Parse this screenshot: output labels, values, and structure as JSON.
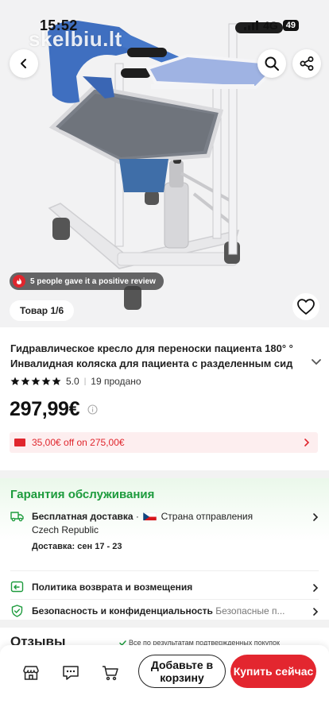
{
  "status_bar": {
    "time": "15:52",
    "network": "4G",
    "battery": "49"
  },
  "watermark": "skelbiu.lt",
  "hero": {
    "review_badge": "5 people gave it a positive review",
    "image_counter": "Товар 1/6"
  },
  "product": {
    "title_line1": "Гидравлическое кресло для переноски пациента 180° °",
    "title_line2": "Инвалидная коляска для пациента с разделенным сид",
    "rating": "5.0",
    "sold": "19 продано",
    "price": "297,99€",
    "coupon": "35,00€ off on 275,00€"
  },
  "guarantee": {
    "title": "Гарантия обслуживания",
    "shipping_label": "Бесплатная доставка",
    "ship_from_label": "Страна отправления",
    "ship_from_country": "Czech Republic",
    "delivery": "Доставка: сен 17 - 23",
    "returns": "Политика возврата и возмещения",
    "security": "Безопасность и конфиденциальность",
    "security_hint": "Безопасные п..."
  },
  "reviews": {
    "title": "Отзывы",
    "note": "Все по результатам подтвержденных покупок"
  },
  "bottom_bar": {
    "add_to_cart": "Добавьте в корзину",
    "buy_now": "Купить сейчас"
  },
  "colors": {
    "accent_red": "#e3262f",
    "guarantee_green": "#1d9b3d",
    "chair_blue": "#3f6fc0"
  },
  "icons": [
    "back-icon",
    "search-icon",
    "share-icon",
    "heart-icon",
    "star-icon",
    "info-icon",
    "truck-icon",
    "return-icon",
    "shield-icon",
    "store-icon",
    "chat-icon",
    "cart-icon",
    "chevron-right-icon",
    "chevron-down-icon"
  ]
}
